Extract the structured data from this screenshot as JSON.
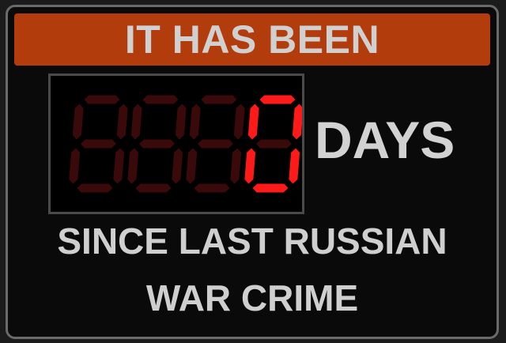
{
  "sign": {
    "header": "IT HAS BEEN",
    "unit": "DAYS",
    "line1": "SINCE LAST RUSSIAN",
    "line2": "WAR CRIME"
  },
  "counter": {
    "value": "0",
    "digits": 4,
    "lit_color": "#ff1a1a",
    "unlit_color": "#3a0a0a",
    "header_color": "#b23c0c"
  }
}
